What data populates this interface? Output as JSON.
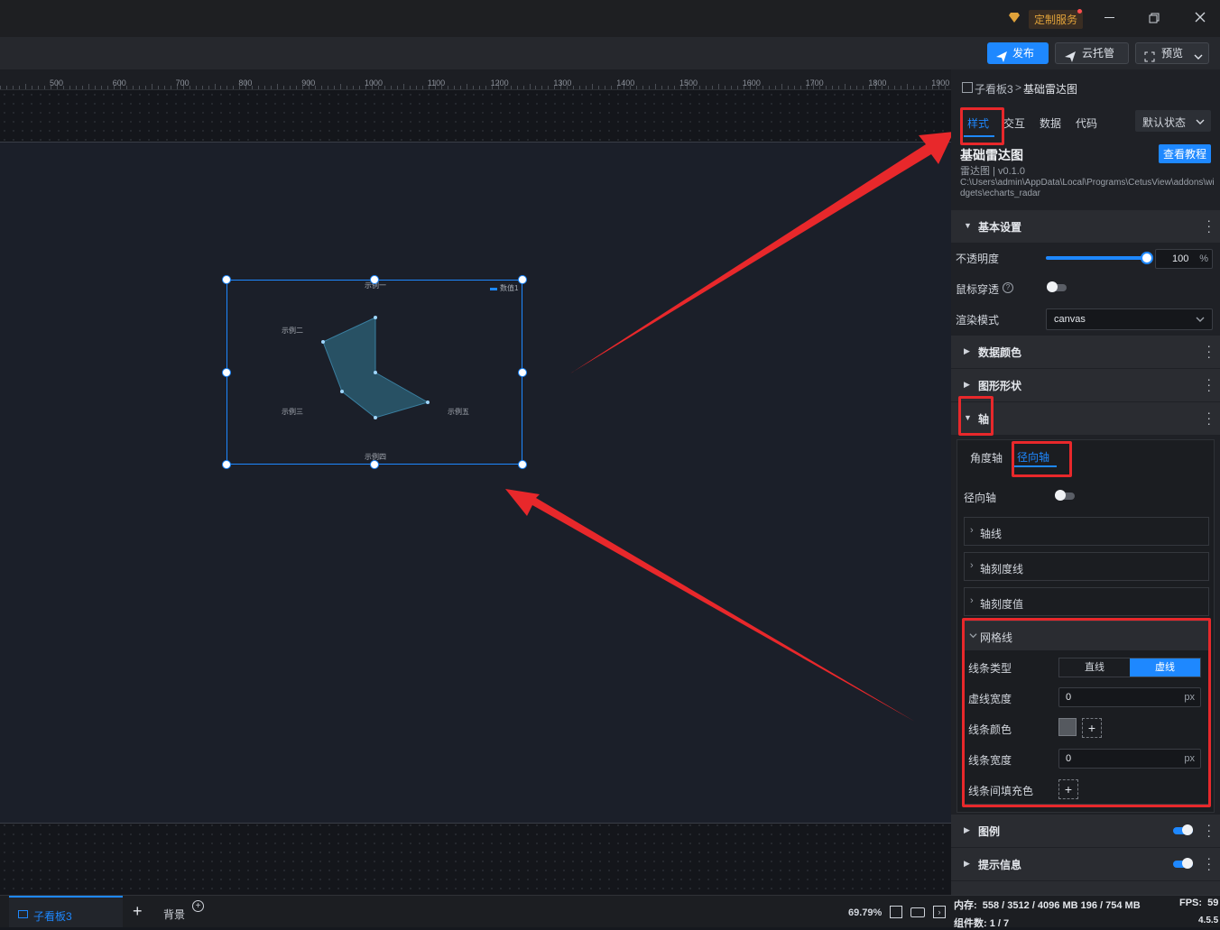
{
  "titlebar": {
    "custom_service": "定制服务"
  },
  "toolbar": {
    "publish": "发布",
    "cloud_host": "云托管",
    "preview": "预览"
  },
  "ruler": {
    "labels": [
      "500",
      "600",
      "700",
      "800",
      "900",
      "1000",
      "1100",
      "1200",
      "1300",
      "1400",
      "1500",
      "1600",
      "1700",
      "1800",
      "1900"
    ]
  },
  "chart_data": {
    "type": "radar",
    "indicators": [
      "示例一",
      "示例二",
      "示例三",
      "示例四",
      "示例五"
    ],
    "series": [
      {
        "name": "数值1"
      }
    ],
    "legend_position": "top-right"
  },
  "panel": {
    "breadcrumb": {
      "parent": "子看板3",
      "sep": ">",
      "current": "基础雷达图"
    },
    "tabs": [
      "样式",
      "交互",
      "数据",
      "代码"
    ],
    "active_tab": "样式",
    "state_select": "默认状态",
    "widget_title": "基础雷达图",
    "tutorial_btn": "查看教程",
    "widget_version": "雷达图 | v0.1.0",
    "widget_path": "C:\\Users\\admin\\AppData\\Local\\Programs\\CetusView\\addons\\widgets\\echarts_radar",
    "sections": {
      "basic": "基本设置",
      "data_color": "数据颜色",
      "shape": "图形形状",
      "axis": "轴",
      "legend": "图例",
      "tooltip": "提示信息"
    },
    "basic": {
      "opacity_label": "不透明度",
      "opacity_value": "100",
      "opacity_unit": "%",
      "opacity_fraction": 1.0,
      "mouse_through_label": "鼠标穿透",
      "render_label": "渲染模式",
      "render_value": "canvas"
    },
    "axis": {
      "tabs": [
        "角度轴",
        "径向轴"
      ],
      "active": "径向轴",
      "radial_label": "径向轴",
      "subsections": [
        "轴线",
        "轴刻度线",
        "轴刻度值"
      ],
      "grid": {
        "title": "网格线",
        "line_type_label": "线条类型",
        "line_type_options": [
          "直线",
          "虚线"
        ],
        "line_type_active": "虚线",
        "dash_width_label": "虚线宽度",
        "dash_width_value": "0",
        "unit": "px",
        "line_color_label": "线条颜色",
        "line_width_label": "线条宽度",
        "line_width_value": "0",
        "fill_label": "线条间填充色"
      }
    }
  },
  "status": {
    "tab_name": "子看板3",
    "add": "+",
    "background": "背景",
    "zoom": "69.79%",
    "memory": "内存:  558 / 3512 / 4096 MB 196 / 754 MB",
    "fps": "FPS:  59",
    "components": "组件数: 1 / 7",
    "version": "4.5.5"
  },
  "colors": {
    "accent": "#1e88ff",
    "red_annotation": "#e8282b",
    "radar_fill": "#2a5a6e"
  }
}
